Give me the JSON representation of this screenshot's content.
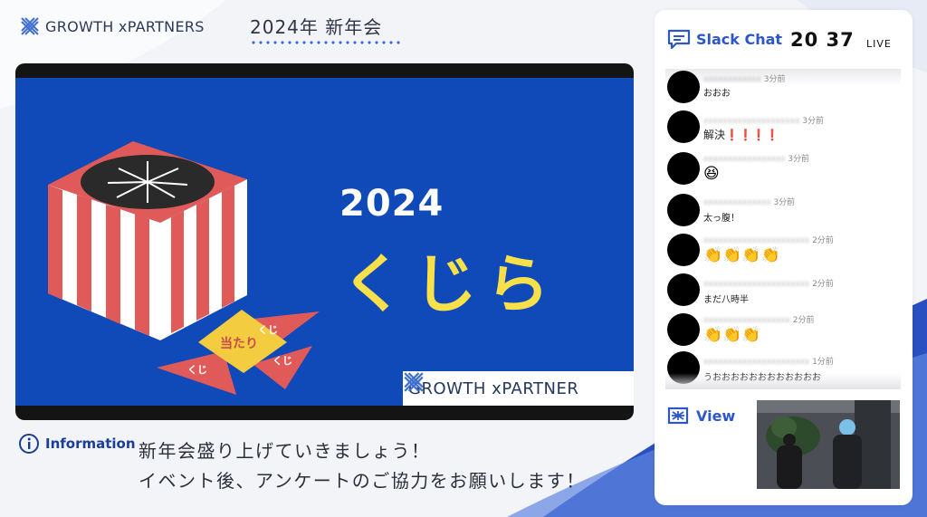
{
  "header": {
    "brand": "GROWTH xPARTNERS",
    "event_title": "2024年 新年会"
  },
  "slide": {
    "year": "2024",
    "title": "くじら",
    "tag_hit": "当たり",
    "tag_kuji_1": "くじ",
    "tag_kuji_2": "くじ",
    "tag_kuji_3": "くじ",
    "logo": "GROWTH xPARTNER"
  },
  "information": {
    "label": "Information",
    "line1": "新年会盛り上げていきましょう！",
    "line2": "イベント後、アンケートのご協力をお願いします！"
  },
  "panel": {
    "slack_title": "Slack Chat",
    "time": "20 37",
    "live": "LIVE",
    "view_title": "View",
    "messages": [
      {
        "time": "3分前",
        "text": "おおお"
      },
      {
        "time": "3分前",
        "text": "解決❗❗❗❗"
      },
      {
        "time": "3分前",
        "text": "😆"
      },
      {
        "time": "3分前",
        "text": "太っ腹！"
      },
      {
        "time": "2分前",
        "text": "👏👏👏👏"
      },
      {
        "time": "2分前",
        "text": "まだ八時半"
      },
      {
        "time": "2分前",
        "text": "👏👏👏"
      },
      {
        "time": "1分前",
        "text": "うおおおおおおおおおおおお"
      }
    ]
  },
  "colors": {
    "slide_bg": "#1049b8",
    "accent_blue": "#2d57c7",
    "title_yellow": "#f7e04a",
    "box_red": "#e45a5a"
  }
}
